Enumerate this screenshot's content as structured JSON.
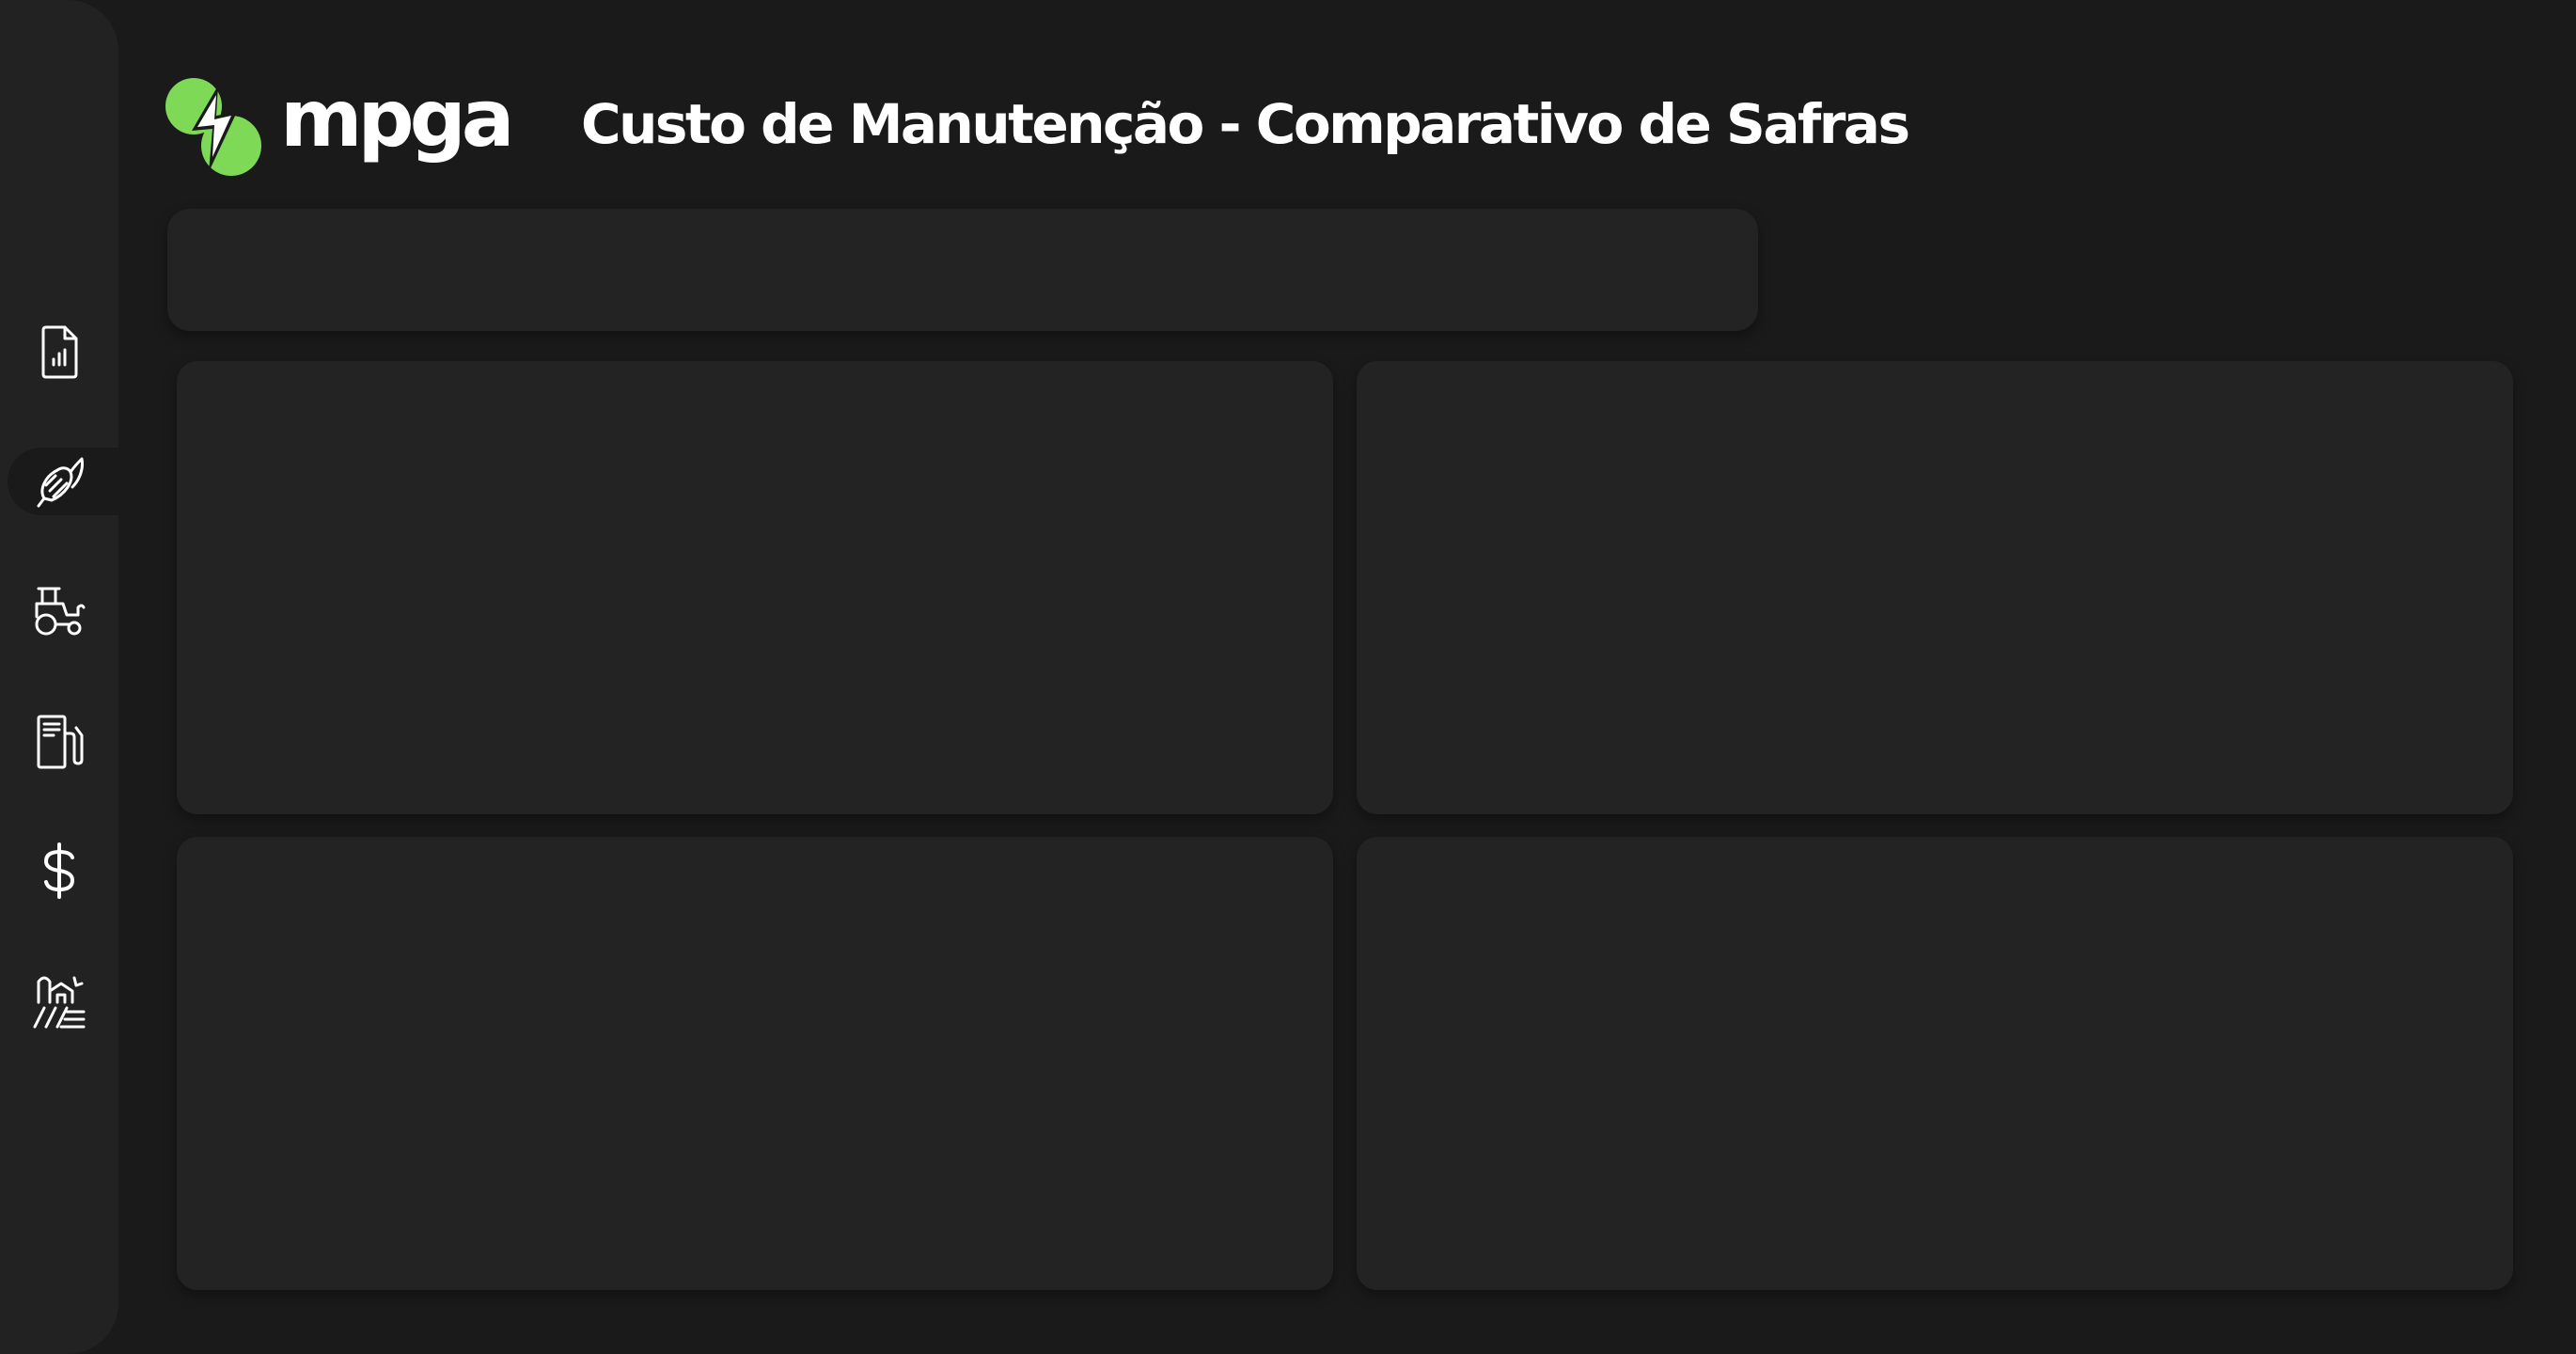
{
  "app": {
    "logo_text": "mpga",
    "brand_color": "#7ed957",
    "background_color": "#1a1a1a",
    "panel_color": "#232323"
  },
  "header": {
    "title": "Custo de Manutenção - Comparativo de Safras"
  },
  "sidebar": {
    "items": [
      {
        "icon": "report-chart-icon",
        "active": false
      },
      {
        "icon": "corn-icon",
        "active": true
      },
      {
        "icon": "tractor-icon",
        "active": false
      },
      {
        "icon": "fuel-pump-icon",
        "active": false
      },
      {
        "icon": "dollar-icon",
        "active": false
      },
      {
        "icon": "farm-field-icon",
        "active": false
      }
    ]
  }
}
